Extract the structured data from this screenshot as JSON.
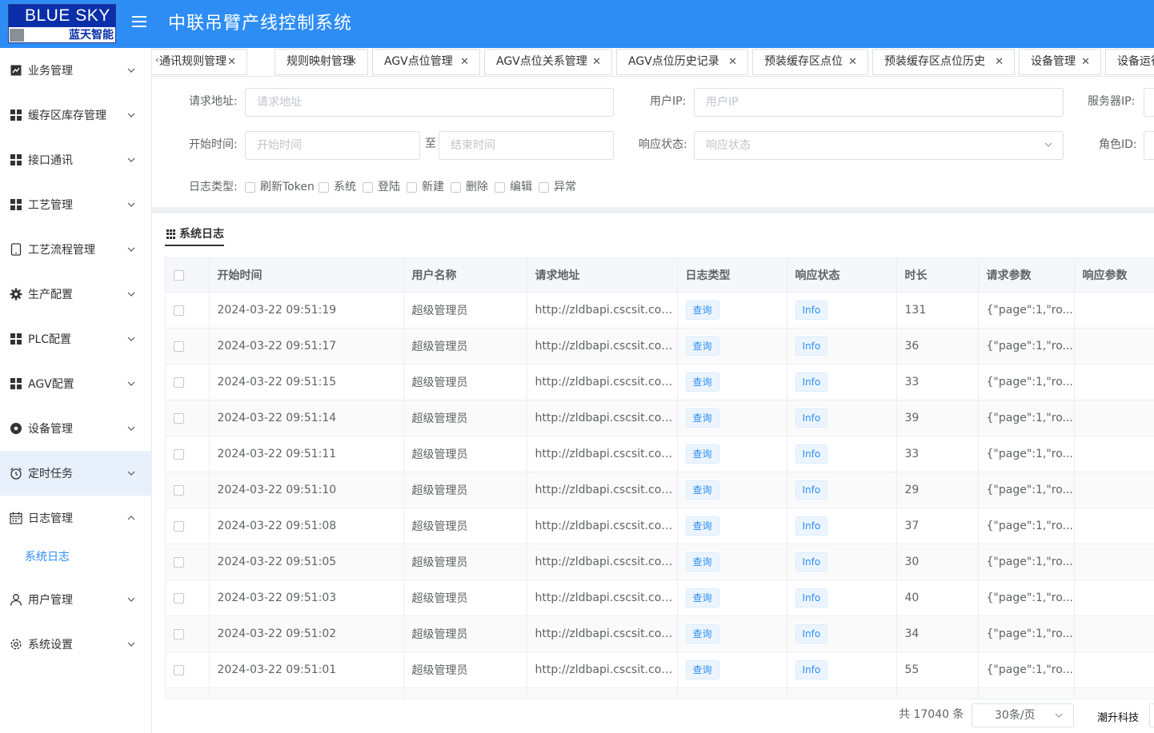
{
  "header": {
    "logo_text": "BLUE SKY",
    "logo_subtext": "蓝天智能",
    "app_title": "中联吊臂产线控制系统"
  },
  "sidebar": {
    "items": [
      {
        "label": "业务管理",
        "icon": "trend-chart-icon"
      },
      {
        "label": "缓存区库存管理",
        "icon": "grid-icon"
      },
      {
        "label": "接口通讯",
        "icon": "grid-icon"
      },
      {
        "label": "工艺管理",
        "icon": "grid-icon"
      },
      {
        "label": "工艺流程管理",
        "icon": "tablet-icon"
      },
      {
        "label": "生产配置",
        "icon": "gear-icon"
      },
      {
        "label": "PLC配置",
        "icon": "grid-icon"
      },
      {
        "label": "AGV配置",
        "icon": "grid-icon"
      },
      {
        "label": "设备管理",
        "icon": "gear-filled-icon"
      },
      {
        "label": "定时任务",
        "icon": "alarm-clock-icon"
      },
      {
        "label": "日志管理",
        "icon": "calendar-icon"
      },
      {
        "label": "用户管理",
        "icon": "user-icon"
      },
      {
        "label": "系统设置",
        "icon": "settings-icon"
      }
    ],
    "sub_item": "系统日志",
    "active_color": "#e8f0fb"
  },
  "tabs": [
    "通讯规则管理",
    "规则映射管理",
    "AGV点位管理",
    "AGV点位关系管理",
    "AGV点位历史记录",
    "预装缓存区点位",
    "预装缓存区点位历史",
    "设备管理",
    "设备运行"
  ],
  "filters": {
    "request_url_label": "请求地址:",
    "request_url_placeholder": "请求地址",
    "user_ip_label": "用户IP:",
    "user_ip_placeholder": "用户IP",
    "server_ip_label": "服务器IP:",
    "start_time_label": "开始时间:",
    "start_time_placeholder": "开始时间",
    "to_label": "至",
    "end_time_placeholder": "结束时间",
    "response_status_label": "响应状态:",
    "response_status_placeholder": "响应状态",
    "role_id_label": "角色ID:",
    "log_type_label": "日志类型:",
    "log_types": [
      "刷新Token",
      "系统",
      "登陆",
      "新建",
      "删除",
      "编辑",
      "异常"
    ]
  },
  "table": {
    "title": "系统日志",
    "columns": [
      "开始时间",
      "用户名称",
      "请求地址",
      "日志类型",
      "响应状态",
      "时长",
      "请求参数",
      "响应参数"
    ],
    "rows": [
      {
        "time": "2024-03-22 09:51:19",
        "user": "超级管理员",
        "url": "http://zldbapi.cscsit.com/...",
        "type": "查询",
        "status": "Info",
        "duration": "131",
        "params": "{\"page\":1,\"ro..."
      },
      {
        "time": "2024-03-22 09:51:17",
        "user": "超级管理员",
        "url": "http://zldbapi.cscsit.com/...",
        "type": "查询",
        "status": "Info",
        "duration": "36",
        "params": "{\"page\":1,\"ro..."
      },
      {
        "time": "2024-03-22 09:51:15",
        "user": "超级管理员",
        "url": "http://zldbapi.cscsit.com/...",
        "type": "查询",
        "status": "Info",
        "duration": "33",
        "params": "{\"page\":1,\"ro..."
      },
      {
        "time": "2024-03-22 09:51:14",
        "user": "超级管理员",
        "url": "http://zldbapi.cscsit.com/...",
        "type": "查询",
        "status": "Info",
        "duration": "39",
        "params": "{\"page\":1,\"ro..."
      },
      {
        "time": "2024-03-22 09:51:11",
        "user": "超级管理员",
        "url": "http://zldbapi.cscsit.com/...",
        "type": "查询",
        "status": "Info",
        "duration": "33",
        "params": "{\"page\":1,\"ro..."
      },
      {
        "time": "2024-03-22 09:51:10",
        "user": "超级管理员",
        "url": "http://zldbapi.cscsit.com/...",
        "type": "查询",
        "status": "Info",
        "duration": "29",
        "params": "{\"page\":1,\"ro..."
      },
      {
        "time": "2024-03-22 09:51:08",
        "user": "超级管理员",
        "url": "http://zldbapi.cscsit.com/...",
        "type": "查询",
        "status": "Info",
        "duration": "37",
        "params": "{\"page\":1,\"ro..."
      },
      {
        "time": "2024-03-22 09:51:05",
        "user": "超级管理员",
        "url": "http://zldbapi.cscsit.com/...",
        "type": "查询",
        "status": "Info",
        "duration": "30",
        "params": "{\"page\":1,\"ro..."
      },
      {
        "time": "2024-03-22 09:51:03",
        "user": "超级管理员",
        "url": "http://zldbapi.cscsit.com/...",
        "type": "查询",
        "status": "Info",
        "duration": "40",
        "params": "{\"page\":1,\"ro..."
      },
      {
        "time": "2024-03-22 09:51:02",
        "user": "超级管理员",
        "url": "http://zldbapi.cscsit.com/...",
        "type": "查询",
        "status": "Info",
        "duration": "34",
        "params": "{\"page\":1,\"ro..."
      },
      {
        "time": "2024-03-22 09:51:01",
        "user": "超级管理员",
        "url": "http://zldbapi.cscsit.com/...",
        "type": "查询",
        "status": "Info",
        "duration": "55",
        "params": "{\"page\":1,\"ro..."
      }
    ]
  },
  "pagination": {
    "total_text": "共 17040 条",
    "page_size": "30条/页"
  },
  "watermark": "潮升科技",
  "colors": {
    "primary": "#2e8df5",
    "tag_bg": "#ecf5ff"
  }
}
